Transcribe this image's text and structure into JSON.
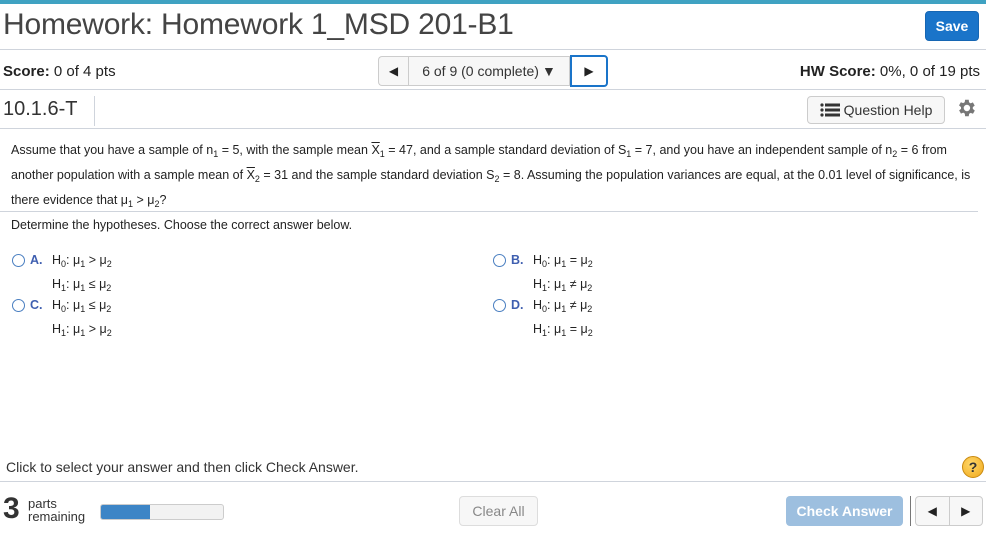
{
  "header": {
    "title": "Homework: Homework 1_MSD 201-B1",
    "save_label": "Save",
    "accent_color": "#3fa2c2",
    "save_color": "#1a74c9"
  },
  "scorebar": {
    "score_label": "Score:",
    "score_value": "0 of 4 pts",
    "nav_prev_icon": "◀",
    "nav_select": "6 of 9 (0 complete)",
    "nav_caret": "▼",
    "nav_next_icon": "▶",
    "hw_score_label": "HW Score:",
    "hw_score_value": "0%, 0 of 19 pts"
  },
  "question_bar": {
    "question_id": "10.1.6-T",
    "help_label": "Question Help"
  },
  "question": {
    "p1": "Assume that you have a sample of n",
    "n1_sub": "1",
    "p2": " = 5, with the sample mean ",
    "x1": "X",
    "x1_sub": "1",
    "p3": " = 47, and a sample standard deviation of S",
    "s1_sub": "1",
    "p4": " = 7, and you have an independent sample of n",
    "n2_sub": "2",
    "p5": " = 6 from another population with a sample mean of ",
    "x2": "X",
    "x2_sub": "2",
    "p6": " = 31 and the sample standard deviation S",
    "s2_sub": "2",
    "p7": " = 8.  Assuming the population variances are equal, at the 0.01 level of significance, is there evidence that μ",
    "mu1_sub": "1",
    "p8": " > μ",
    "mu2_sub": "2",
    "p9": "?"
  },
  "prompt": "Determine the hypotheses. Choose the correct answer below.",
  "choices": [
    {
      "letter": "A.",
      "h0_op": ">",
      "h1_op": "≤"
    },
    {
      "letter": "B.",
      "h0_op": "=",
      "h1_op": "≠"
    },
    {
      "letter": "C.",
      "h0_op": "≤",
      "h1_op": ">"
    },
    {
      "letter": "D.",
      "h0_op": "≠",
      "h1_op": "="
    }
  ],
  "hyp": {
    "h": "H",
    "h0_sub": "0",
    "h1_sub": "1",
    "colon": ": ",
    "mu": "μ",
    "s1": "1",
    "s2": "2"
  },
  "footer": {
    "instruction": "Click to select your answer and then click Check Answer.",
    "help_icon": "?",
    "parts_count": "3",
    "parts_line1": "parts",
    "parts_line2": "remaining",
    "progress_fraction": 0.4,
    "clear_label": "Clear All",
    "check_label": "Check Answer",
    "prev_icon": "◀",
    "next_icon": "▶"
  }
}
